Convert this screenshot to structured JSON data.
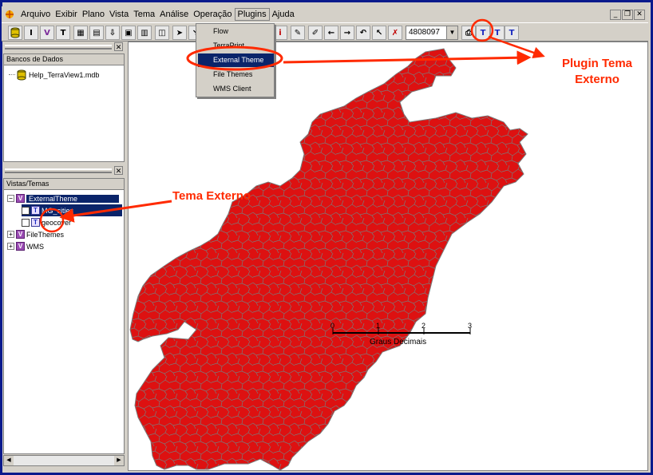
{
  "menubar": {
    "items": [
      "Arquivo",
      "Exibir",
      "Plano",
      "Vista",
      "Tema",
      "Análise",
      "Operação",
      "Plugins",
      "Ajuda"
    ],
    "active": "Plugins"
  },
  "toolbar": {
    "scale_value": "4808097"
  },
  "plugins_menu": {
    "items": [
      "Flow",
      "TerraPrint",
      "External Theme",
      "File Themes",
      "WMS Client"
    ],
    "highlighted": "External Theme"
  },
  "databases_panel": {
    "header": "Bancos de Dados",
    "items": [
      {
        "label": "Help_TerraView1.mdb",
        "icon": "database-icon"
      }
    ]
  },
  "views_panel": {
    "header": "Vistas/Temas",
    "items": [
      {
        "label": "ExternalTheme",
        "type": "view",
        "expanded": true,
        "selected": true
      },
      {
        "label": "MG_cities",
        "type": "theme",
        "checked": true
      },
      {
        "label": "geocover",
        "type": "theme",
        "checked": false
      },
      {
        "label": "FileThemes",
        "type": "view",
        "expanded": false
      },
      {
        "label": "WMS",
        "type": "view",
        "expanded": false
      }
    ]
  },
  "scale_bar": {
    "ticks": [
      "0",
      "1",
      "2",
      "3"
    ],
    "label": "Graus Decimais"
  },
  "annotations": {
    "plugin_callout_line1": "Plugin Tema",
    "plugin_callout_line2": "Externo",
    "theme_callout": "Tema Externo"
  },
  "colors": {
    "map_fill": "#dd1111",
    "map_borders": "#7a7a7a",
    "callout": "#ff2a00",
    "frame": "#0a1a8c",
    "selection": "#0a246a"
  }
}
